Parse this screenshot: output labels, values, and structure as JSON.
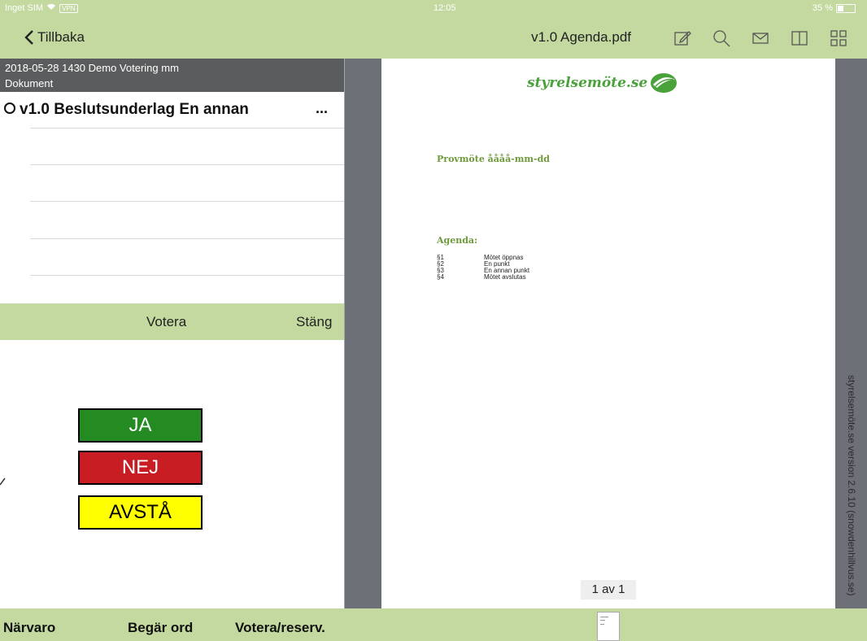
{
  "status_bar": {
    "carrier": "Inget SIM",
    "vpn": "VPN",
    "time": "12:05",
    "battery": "35 %",
    "battery_level": 0.35
  },
  "nav": {
    "back_label": "Tillbaka",
    "document_title": "v1.0 Agenda.pdf",
    "icons": [
      "edit-icon",
      "search-icon",
      "mail-icon",
      "book-icon",
      "grid-icon"
    ]
  },
  "meeting": {
    "title": "2018-05-28 1430  Demo Votering mm",
    "section": "Dokument"
  },
  "documents": [
    {
      "name": "v1.0 Beslutsunderlag En annan",
      "more": "..."
    }
  ],
  "vote_bar": {
    "vote_label": "Votera",
    "close_label": "Stäng"
  },
  "vote_options": {
    "yes": "JA",
    "no": "NEJ",
    "abstain": "AVSTÅ"
  },
  "bottom_bar": {
    "presence": "Närvaro",
    "request_word": "Begär ord",
    "vote_reserve": "Votera/reserv."
  },
  "pdf": {
    "brand": "styrelsemöte.se",
    "heading": "Provmöte åååå-mm-dd",
    "agenda_title": "Agenda:",
    "agenda_items": [
      {
        "num": "§1",
        "text": "Mötet öppnas"
      },
      {
        "num": "§2",
        "text": "En punkt"
      },
      {
        "num": "§3",
        "text": "En annan punkt"
      },
      {
        "num": "§4",
        "text": "Mötet avslutas"
      }
    ],
    "page_indicator": "1 av 1",
    "watermark": "styrelsemöte.se version 2.6.10 (snowdenhillvus.se)"
  },
  "colors": {
    "bar_green": "#c3d9a0",
    "header_gray": "#5b5c5d",
    "yes_green": "#238b22",
    "no_red": "#c81e23",
    "abstain_yellow": "#ffff00",
    "brand_green": "#4aa23a"
  }
}
